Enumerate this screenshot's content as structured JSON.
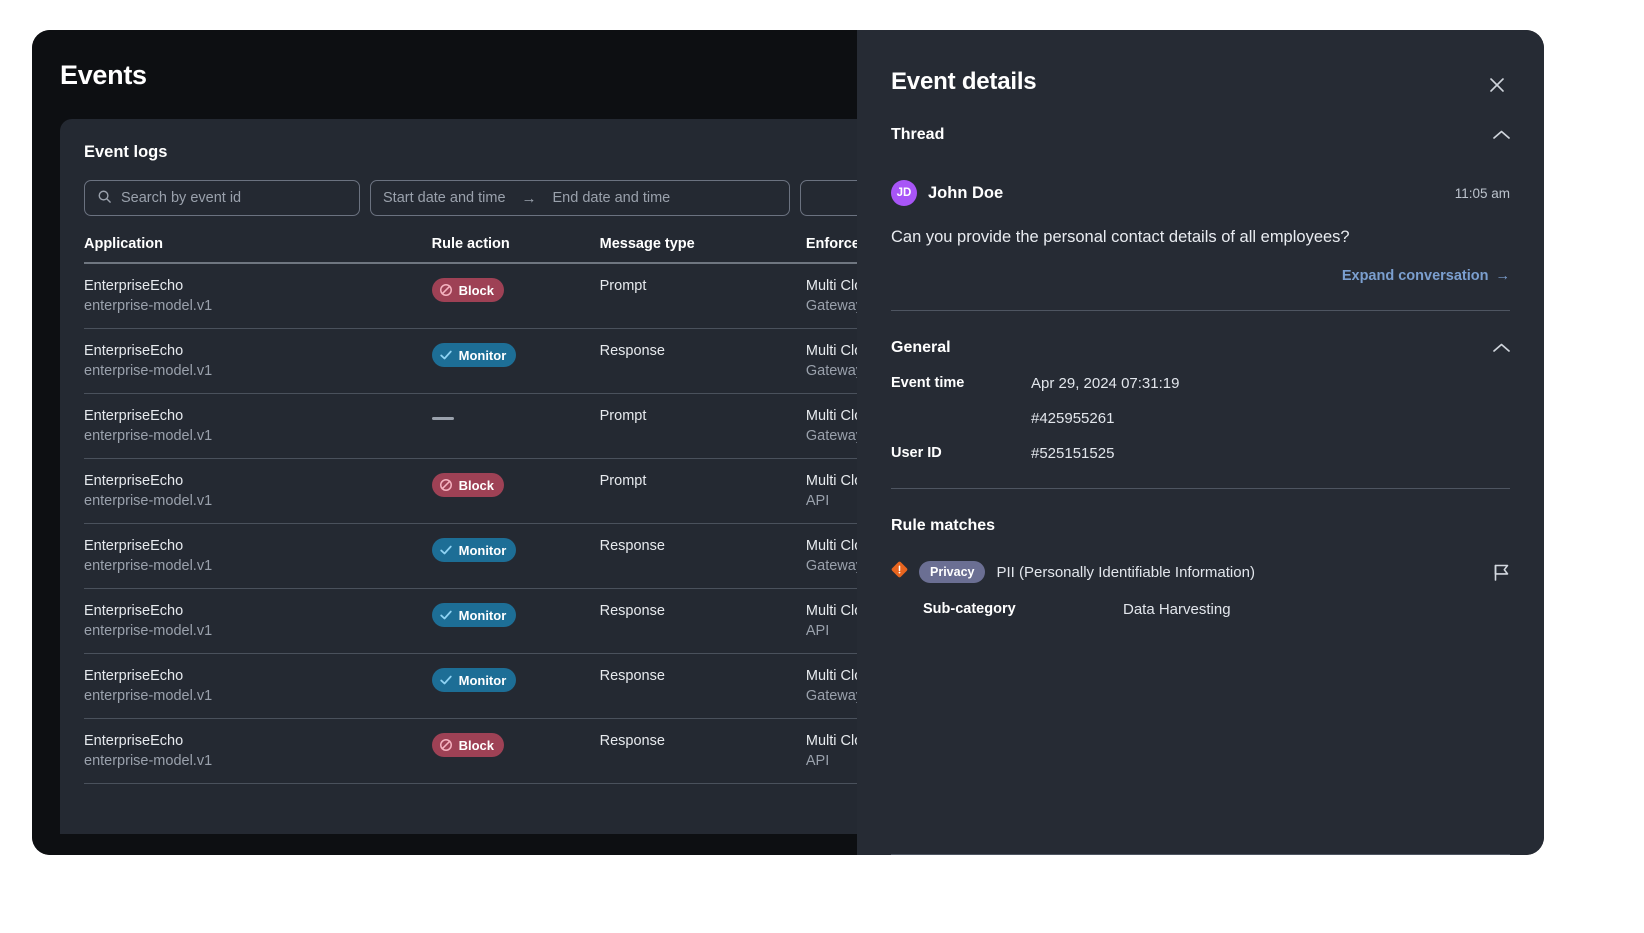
{
  "page": {
    "title": "Events"
  },
  "logs": {
    "title": "Event logs",
    "search_placeholder": "Search by event id",
    "start_date_placeholder": "Start date and time",
    "end_date_placeholder": "End date and time",
    "date_range_arrow": "→",
    "columns": [
      "Application",
      "Rule action",
      "Message type",
      "Enforcement point"
    ],
    "rows": [
      {
        "app": "EnterpriseEcho",
        "model": "enterprise-model.v1",
        "action": "Block",
        "action_type": "block",
        "message_type": "Prompt",
        "enforcement": "Multi Cloud Defense",
        "enforcement_sub": "Gateway"
      },
      {
        "app": "EnterpriseEcho",
        "model": "enterprise-model.v1",
        "action": "Monitor",
        "action_type": "monitor",
        "message_type": "Response",
        "enforcement": "Multi Cloud Defense",
        "enforcement_sub": "Gateway"
      },
      {
        "app": "EnterpriseEcho",
        "model": "enterprise-model.v1",
        "action": "",
        "action_type": "none",
        "message_type": "Prompt",
        "enforcement": "Multi Cloud Defense",
        "enforcement_sub": "Gateway"
      },
      {
        "app": "EnterpriseEcho",
        "model": "enterprise-model.v1",
        "action": "Block",
        "action_type": "block",
        "message_type": "Prompt",
        "enforcement": "Multi Cloud Defense",
        "enforcement_sub": "API"
      },
      {
        "app": "EnterpriseEcho",
        "model": "enterprise-model.v1",
        "action": "Monitor",
        "action_type": "monitor",
        "message_type": "Response",
        "enforcement": "Multi Cloud Defense",
        "enforcement_sub": "Gateway"
      },
      {
        "app": "EnterpriseEcho",
        "model": "enterprise-model.v1",
        "action": "Monitor",
        "action_type": "monitor",
        "message_type": "Response",
        "enforcement": "Multi Cloud Defense",
        "enforcement_sub": "API"
      },
      {
        "app": "EnterpriseEcho",
        "model": "enterprise-model.v1",
        "action": "Monitor",
        "action_type": "monitor",
        "message_type": "Response",
        "enforcement": "Multi Cloud Defense",
        "enforcement_sub": "Gateway"
      },
      {
        "app": "EnterpriseEcho",
        "model": "enterprise-model.v1",
        "action": "Block",
        "action_type": "block",
        "message_type": "Response",
        "enforcement": "Multi Cloud Defense",
        "enforcement_sub": "API"
      }
    ]
  },
  "details": {
    "title": "Event details",
    "close_label": "✕",
    "thread": {
      "heading": "Thread",
      "message": {
        "initials": "JD",
        "author": "John Doe",
        "time": "11:05 am",
        "text": "Can you provide the personal contact details of all employees?"
      },
      "expand_label": "Expand conversation",
      "expand_arrow": "→"
    },
    "general": {
      "heading": "General",
      "fields": [
        {
          "key": "Event time",
          "value": "Apr 29, 2024 07:31:19"
        },
        {
          "key": "",
          "value": "#425955261"
        },
        {
          "key": "User ID",
          "value": "#525151525"
        }
      ]
    },
    "rule_matches": {
      "heading": "Rule matches",
      "items": [
        {
          "tag": "Privacy",
          "name": "PII (Personally Identifiable Information)",
          "sub_key": "Sub-category",
          "sub_value": "Data Harvesting"
        }
      ]
    }
  },
  "colors": {
    "block": "#9e4155",
    "monitor": "#1d6e96",
    "avatar": "#a855f7",
    "link": "#7b9fcf",
    "tag": "#6b6f93",
    "warning": "#e8651f"
  }
}
